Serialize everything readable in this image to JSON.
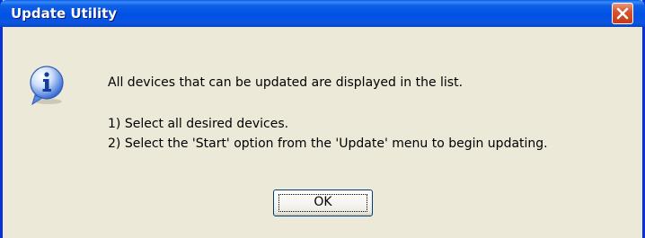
{
  "window": {
    "title": "Update Utility",
    "close_icon": "close-icon"
  },
  "dialog": {
    "icon": "info-icon",
    "message_line1": "All devices that can be updated are displayed in the list.",
    "message_line2": "1) Select all desired devices.",
    "message_line3": "2) Select the 'Start' option from the 'Update' menu to begin updating.",
    "ok_label": "OK"
  },
  "colors": {
    "titlebar": "#0052e6",
    "window_border": "#0831d9",
    "body_background": "#ece9d8",
    "close_button": "#d8532f",
    "info_icon": "#3b6fd6"
  }
}
